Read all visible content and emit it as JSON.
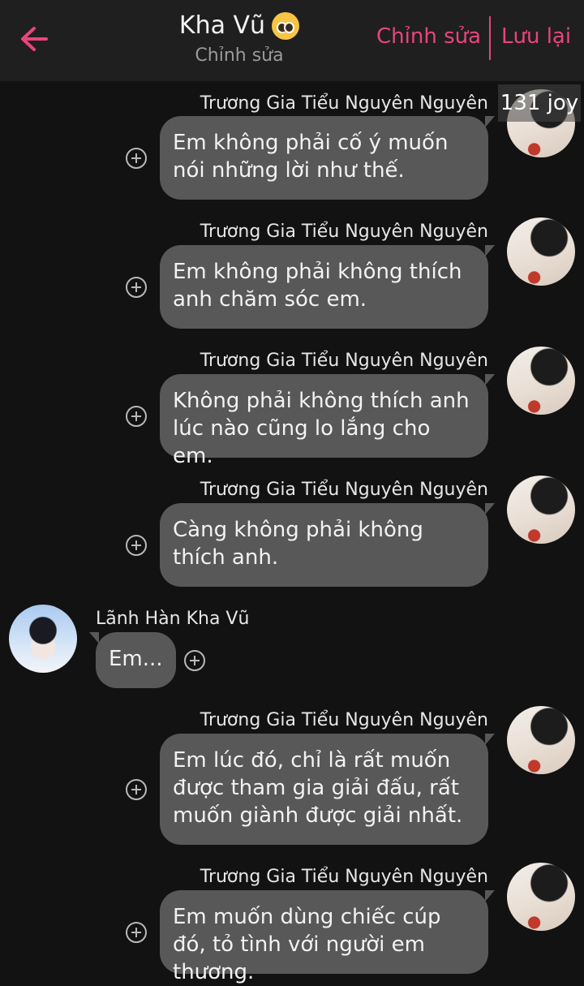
{
  "header": {
    "title": "Kha Vũ",
    "subtitle": "Chỉnh sửa",
    "edit_label": "Chỉnh sửa",
    "save_label": "Lưu lại",
    "accent_color": "#e8457b"
  },
  "counter": "131 joy",
  "messages": [
    {
      "side": "right",
      "sender": "Trương Gia Tiểu Nguyên Nguyên",
      "text": "Em không phải cố ý muốn nói những lời như thế."
    },
    {
      "side": "right",
      "sender": "Trương Gia Tiểu Nguyên Nguyên",
      "text": "Em không phải không thích anh chăm sóc em."
    },
    {
      "side": "right",
      "sender": "Trương Gia Tiểu Nguyên Nguyên",
      "text": "Không phải không thích anh lúc nào cũng lo lắng cho em."
    },
    {
      "side": "right",
      "sender": "Trương Gia Tiểu Nguyên Nguyên",
      "text": "Càng không phải không thích anh."
    },
    {
      "side": "left",
      "sender": "Lãnh Hàn Kha Vũ",
      "text": "Em..."
    },
    {
      "side": "right",
      "sender": "Trương Gia Tiểu Nguyên Nguyên",
      "text": "Em lúc đó, chỉ là rất muốn được tham gia giải đấu, rất muốn giành được giải nhất."
    },
    {
      "side": "right",
      "sender": "Trương Gia Tiểu Nguyên Nguyên",
      "text": "Em muốn dùng chiếc cúp đó, tỏ tình với người em thương."
    }
  ]
}
